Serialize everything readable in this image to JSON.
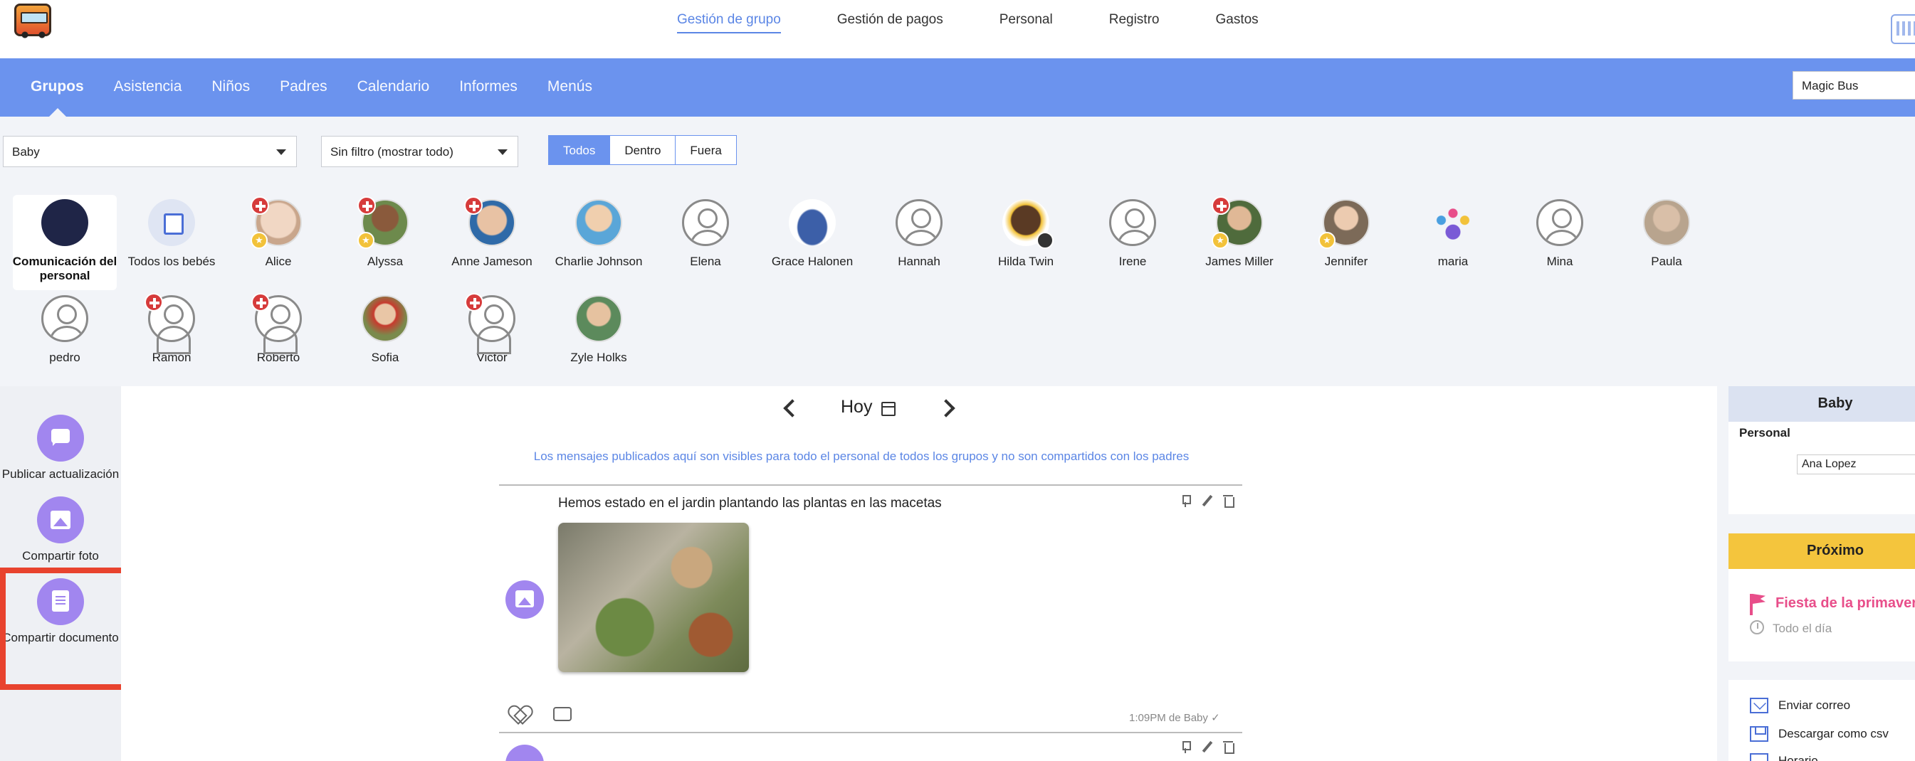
{
  "topnav": {
    "items": [
      "Gestión de grupo",
      "Gestión de pagos",
      "Personal",
      "Registro",
      "Gastos"
    ]
  },
  "subnav": {
    "items": [
      "Grupos",
      "Asistencia",
      "Niños",
      "Padres",
      "Calendario",
      "Informes",
      "Menús"
    ],
    "school": "Magic Bus"
  },
  "filters": {
    "group": "Baby",
    "filter": "Sin filtro (mostrar todo)",
    "segments": [
      "Todos",
      "Dentro",
      "Fuera"
    ]
  },
  "children": {
    "staff_comm": "Comunicación del personal",
    "all_babies": "Todos los bebés",
    "names": [
      "Alice",
      "Alyssa",
      "Anne Jameson",
      "Charlie Johnson",
      "Elena",
      "Grace Halonen",
      "Hannah",
      "Hilda Twin",
      "Irene",
      "James Miller",
      "Jennifer",
      "maria",
      "Mina",
      "Paula",
      "pedro",
      "Ramón",
      "Roberto",
      "Sofia",
      "Victor",
      "Zyle Holks"
    ]
  },
  "actions": {
    "post_update": "Publicar actualización",
    "share_photo": "Compartir foto",
    "share_doc": "Compartir documento"
  },
  "feed": {
    "date_label": "Hoy",
    "notice": "Los mensajes publicados aquí son visibles para todo el personal de todos los grupos y no son compartidos con los padres",
    "post1_text": "Hemos estado en el jardin plantando las plantas en las macetas",
    "post1_meta": "1:09PM de Baby ✓"
  },
  "rightpanel": {
    "group_title": "Baby",
    "personal_label": "Personal",
    "staff_select": "Ana Lopez",
    "upcoming_title": "Próximo",
    "event_name": "Fiesta de la primavera",
    "event_time": "Todo el día",
    "links": [
      "Enviar correo",
      "Descargar como csv",
      "Horario"
    ]
  },
  "colors": {
    "brand_blue": "#6b93ee",
    "accent_purple": "#a186ef",
    "highlight_red": "#e8432e",
    "upcoming_yellow": "#f4c53d",
    "event_pink": "#e84e8a"
  }
}
